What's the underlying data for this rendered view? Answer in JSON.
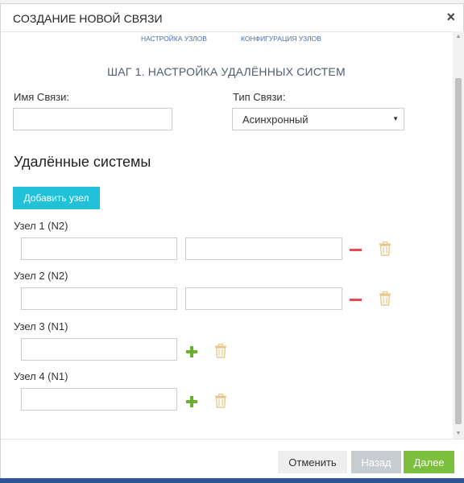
{
  "dialog": {
    "title": "СОЗДАНИЕ НОВОЙ СВЯЗИ",
    "close_label": "×"
  },
  "steps": [
    {
      "label": "НАСТРОЙКА УЗЛОВ"
    },
    {
      "label": "КОНФИГУРАЦИЯ УЗЛОВ"
    }
  ],
  "step_heading": "ШАГ 1. НАСТРОЙКА УДАЛЁННЫХ СИСТЕМ",
  "form": {
    "link_name_label": "Имя Связи:",
    "link_name_value": "",
    "link_type_label": "Тип Связи:",
    "link_type_value": "Асинхронный"
  },
  "remote_systems": {
    "title": "Удалённые системы",
    "add_node_label": "Добавить узел",
    "nodes": [
      {
        "label": "Узел 1 (N2)",
        "action": "remove"
      },
      {
        "label": "Узел 2 (N2)",
        "action": "remove"
      },
      {
        "label": "Узел 3 (N1)",
        "action": "add"
      },
      {
        "label": "Узел 4 (N1)",
        "action": "add"
      }
    ]
  },
  "footer": {
    "cancel_label": "Отменить",
    "back_label": "Назад",
    "next_label": "Далее"
  },
  "colors": {
    "accent_cyan": "#21c2d9",
    "next_green": "#7cbf3c",
    "minus_red": "#e84a53",
    "plus_green": "#69b030",
    "trash_tan": "#e8c98a"
  }
}
